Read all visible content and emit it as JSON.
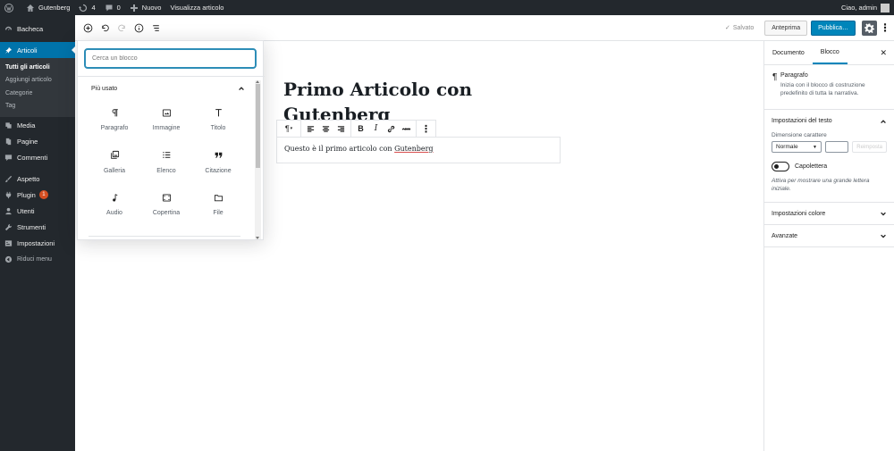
{
  "adminbar": {
    "site_name": "Gutenberg",
    "updates_count": "4",
    "comments_count": "0",
    "new_label": "Nuovo",
    "view_post_label": "Visualizza articolo",
    "greeting": "Ciao, admin"
  },
  "adminmenu": {
    "dashboard": "Bacheca",
    "posts": "Articoli",
    "posts_sub": [
      "Tutti gli articoli",
      "Aggiungi articolo",
      "Categorie",
      "Tag"
    ],
    "media": "Media",
    "pages": "Pagine",
    "comments": "Commenti",
    "appearance": "Aspetto",
    "plugins": "Plugin",
    "plugins_badge": "1",
    "users": "Utenti",
    "tools": "Strumenti",
    "settings": "Impostazioni",
    "collapse": "Riduci menu"
  },
  "header": {
    "saved_label": "Salvato",
    "preview_label": "Anteprima",
    "publish_label": "Pubblica…"
  },
  "inserter": {
    "search_placeholder": "Cerca un blocco",
    "panel_title": "Più usato",
    "blocks": [
      {
        "label": "Paragrafo",
        "icon": "paragraph-icon"
      },
      {
        "label": "Immagine",
        "icon": "image-icon"
      },
      {
        "label": "Titolo",
        "icon": "heading-icon"
      },
      {
        "label": "Galleria",
        "icon": "gallery-icon"
      },
      {
        "label": "Elenco",
        "icon": "list-icon"
      },
      {
        "label": "Citazione",
        "icon": "quote-icon"
      },
      {
        "label": "Audio",
        "icon": "audio-icon"
      },
      {
        "label": "Copertina",
        "icon": "cover-icon"
      },
      {
        "label": "File",
        "icon": "file-icon"
      }
    ]
  },
  "editor": {
    "post_title": "Primo Articolo con Gutenberg",
    "paragraph_before": "Questo è il primo articolo con ",
    "paragraph_link": "Gutenberg",
    "toolbar_abc": "ABC"
  },
  "sidebar": {
    "tab_document": "Documento",
    "tab_block": "Blocco",
    "block_title": "Paragrafo",
    "block_desc": "Inizia con il blocco di costruzione predefinito di tutta la narrativa.",
    "text_settings_title": "Impostazioni del testo",
    "font_size_label": "Dimensione carattere",
    "font_size_value": "Normale",
    "reset_label": "Reimposta",
    "dropcap_label": "Capolettera",
    "dropcap_help": "Attiva per mostrare una grande lettera iniziale.",
    "color_settings_title": "Impostazioni colore",
    "advanced_title": "Avanzate"
  }
}
